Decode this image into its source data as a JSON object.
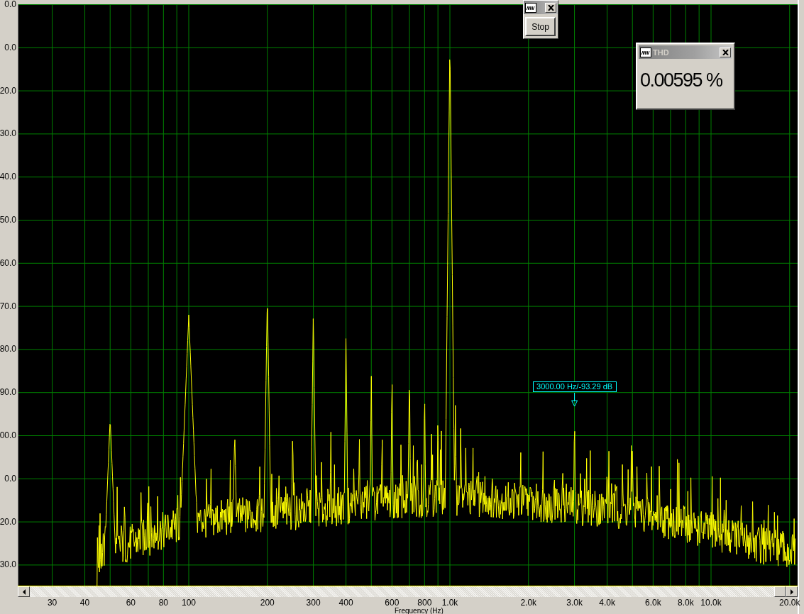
{
  "stop_window": {
    "button": "Stop"
  },
  "thd_window": {
    "title": "THD",
    "value": "0.00595 %"
  },
  "y_axis": {
    "labels": [
      "0.0",
      "0.0",
      "20.0",
      "30.0",
      "40.0",
      "50.0",
      "60.0",
      "70.0",
      "80.0",
      "90.0",
      "00.0",
      "0.0",
      "20.0",
      "30.0"
    ]
  },
  "x_axis": {
    "title": "Frequency (Hz)",
    "labels": [
      "30",
      "40",
      "60",
      "80",
      "100",
      "200",
      "300",
      "400",
      "600",
      "800",
      "1.0k",
      "2.0k",
      "3.0k",
      "4.0k",
      "6.0k",
      "8.0k",
      "10.0k",
      "20.0k"
    ]
  },
  "cursor": {
    "readout": "3000.00 Hz/-93.29 dB"
  }
}
